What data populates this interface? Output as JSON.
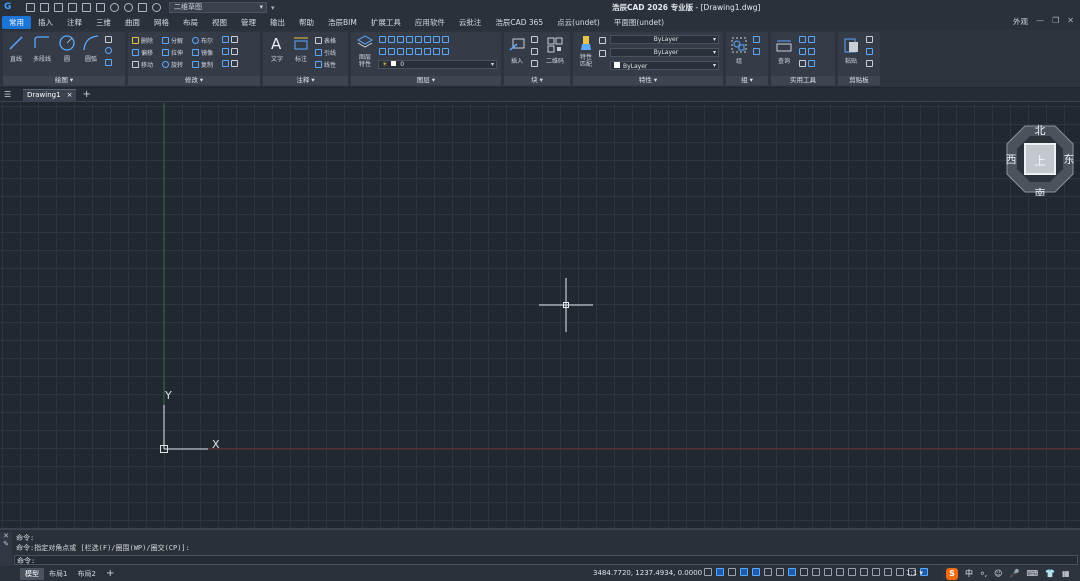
{
  "app": {
    "title_name": "浩辰CAD 2026 专业版",
    "title_file": "- [Drawing1.dwg]",
    "workspace": "二维草图",
    "appearance": "外观"
  },
  "menu_tabs": [
    "常用",
    "插入",
    "注释",
    "三维",
    "曲面",
    "网格",
    "布局",
    "视图",
    "管理",
    "输出",
    "帮助",
    "浩辰BIM",
    "扩展工具",
    "应用软件",
    "云批注",
    "浩辰CAD 365",
    "点云(undet)",
    "平面图(undet)"
  ],
  "ribbon": {
    "draw": {
      "panel": "绘图 ▾",
      "line": "直线",
      "polyline": "多段线",
      "circle": "圆",
      "arc": "圆弧"
    },
    "modify": {
      "panel": "修改 ▾",
      "erase": "删除",
      "explode": "分解",
      "boolean": "布尔",
      "offset": "偏移",
      "stretch": "拉伸",
      "mirror": "镜像",
      "move": "移动",
      "rotate": "旋转",
      "copy": "复制"
    },
    "annotation": {
      "panel": "注释 ▾",
      "text": "文字",
      "dimension": "标注",
      "table": "表格",
      "leader": "引线",
      "linear": "线性"
    },
    "layers": {
      "panel": "图层 ▾",
      "layer_props": "图层特性",
      "current_layer": "0"
    },
    "block": {
      "panel": "块 ▾",
      "insert": "插入",
      "qrcode": "二维码"
    },
    "properties": {
      "panel": "特性 ▾",
      "match": "特性匹配",
      "linetype": "ByLayer",
      "lineweight": "ByLayer",
      "color": "ByLayer"
    },
    "group": {
      "panel": "组 ▾",
      "group": "组"
    },
    "utilities": {
      "panel": "实用工具",
      "query": "查询"
    },
    "clipboard": {
      "panel": "剪贴板",
      "paste": "粘贴"
    }
  },
  "doc_tab": {
    "name": "Drawing1",
    "close": "×",
    "add": "+"
  },
  "viewcube": {
    "north": "北",
    "south": "南",
    "east": "东",
    "west": "西",
    "face": "上"
  },
  "ucs": {
    "x": "X",
    "y": "Y"
  },
  "command": {
    "line1": "命令:",
    "line2": "命令:指定对角点或 [栏选(F)/圈围(WP)/圈交(CP)]:",
    "prompt": "命令:"
  },
  "status": {
    "model": "模型",
    "layout1": "布局1",
    "layout2": "布局2",
    "add": "+",
    "coords": "3484.7720, 1237.4934, 0.0000",
    "scale": "1:1 ▾",
    "ime": [
      "中",
      "⸰,",
      "☺",
      "🎤",
      "⌨",
      "👕",
      "▦"
    ]
  },
  "colors": {
    "accent": "#1b74d8",
    "background": "#212830",
    "x_axis": "#7a3030",
    "y_axis": "#2f6b3b"
  }
}
